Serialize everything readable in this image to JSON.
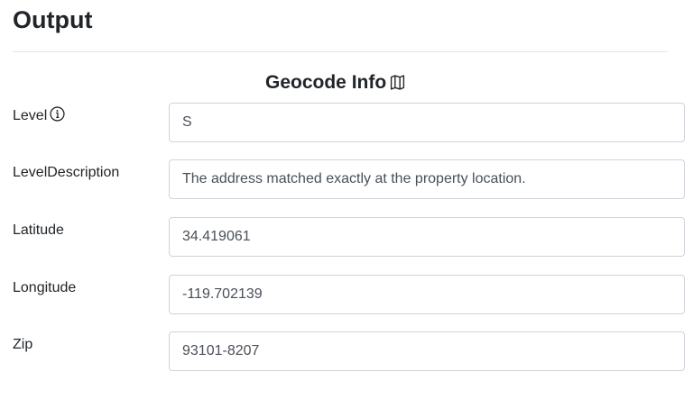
{
  "header": {
    "title": "Output"
  },
  "section": {
    "title": "Geocode Info",
    "icon": "map-icon"
  },
  "fields": [
    {
      "label": "Level",
      "value": "S",
      "icon": "info-icon"
    },
    {
      "label": "LevelDescription",
      "value": "The address matched exactly at the property location."
    },
    {
      "label": "Latitude",
      "value": "34.419061"
    },
    {
      "label": "Longitude",
      "value": "-119.702139"
    },
    {
      "label": "Zip",
      "value": "93101-8207"
    }
  ]
}
